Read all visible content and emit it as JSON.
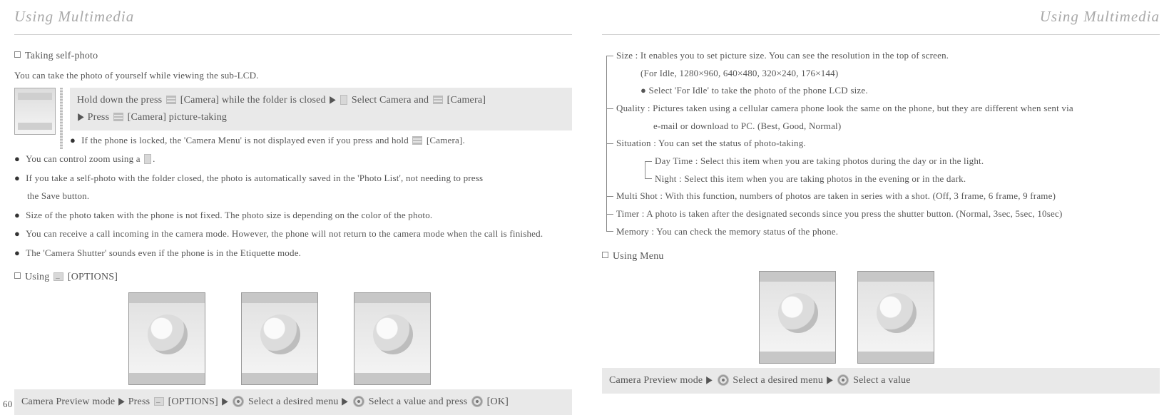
{
  "header": {
    "title": "Using Multimedia"
  },
  "left": {
    "section1_title": "Taking self-photo",
    "section1_intro": "You can take the photo of yourself while viewing the sub-LCD.",
    "instr": {
      "a": "Hold down the press",
      "b": "[Camera] while the folder is closed",
      "c": "Select Camera and",
      "d": "[Camera]",
      "e": "Press",
      "f": "[Camera] picture-taking"
    },
    "note_lock": "If the phone is locked, the 'Camera Menu' is not displayed even if you press and hold",
    "note_lock_end": "[Camera].",
    "bullets": [
      "You can control zoom using a",
      "If you take a self-photo with the folder closed, the photo is automatically saved in the 'Photo List', not needing to press",
      "the Save button.",
      "Size of the photo taken with the phone is not fixed. The photo size is depending on the color of the photo.",
      "You can receive a call incoming in the camera mode. However, the phone will not return to the camera mode when the call is finished.",
      "The 'Camera Shutter' sounds even if the phone is in the Etiquette mode."
    ],
    "section2_title_a": "Using",
    "section2_title_b": "[OPTIONS]",
    "strip": {
      "a": "Camera Preview mode",
      "b": "Press",
      "c": "[OPTIONS]",
      "d": "Select a desired menu",
      "e": "Select a value and press",
      "f": "[OK]"
    },
    "pagenum": "60"
  },
  "right": {
    "tree": {
      "size_a": "Size : It enables you to set picture size. You can see the resolution in the top of screen.",
      "size_b": "(For Idle, 1280×960, 640×480, 320×240, 176×144)",
      "size_c": "Select 'For Idle' to take the photo of the phone LCD size.",
      "quality_a": "Quality : Pictures taken using a cellular camera phone look the same on the phone, but they are different when sent via",
      "quality_b": "e-mail or download to PC. (Best, Good, Normal)",
      "situation": "Situation : You can set the status of photo-taking.",
      "situation_day": "Day Time : Select this item when you are taking photos during the day or in the light.",
      "situation_night": "Night : Select this item when you are taking photos in the evening or in the dark.",
      "multishot": "Multi Shot : With this function, numbers of photos are taken in series with a shot. (Off, 3 frame, 6 frame, 9 frame)",
      "timer": "Timer : A photo is taken after the designated seconds since you press the shutter button. (Normal, 3sec, 5sec, 10sec)",
      "memory": "Memory : You can check the memory status of the phone."
    },
    "section2_title": "Using Menu",
    "strip": {
      "a": "Camera Preview mode",
      "b": "Select a desired menu",
      "c": "Select a value"
    }
  }
}
